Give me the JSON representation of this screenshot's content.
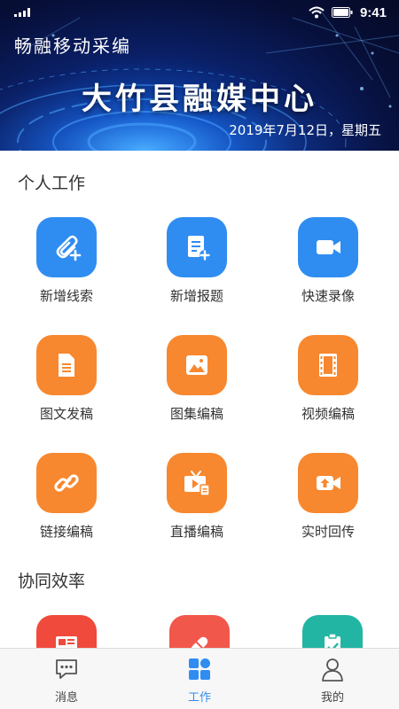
{
  "status_bar": {
    "time": "9:41"
  },
  "header": {
    "app_title": "畅融移动采编",
    "banner_title": "大竹县融媒中心",
    "date": "2019年7月12日，星期五"
  },
  "personal": {
    "title": "个人工作",
    "items": [
      {
        "label": "新增线索",
        "icon": "paperclip-add-icon",
        "color": "#2f8df1"
      },
      {
        "label": "新增报题",
        "icon": "document-add-icon",
        "color": "#2f8df1"
      },
      {
        "label": "快速录像",
        "icon": "video-camera-icon",
        "color": "#2f8df1"
      },
      {
        "label": "图文发稿",
        "icon": "document-icon",
        "color": "#f7882f"
      },
      {
        "label": "图集编稿",
        "icon": "image-icon",
        "color": "#f7882f"
      },
      {
        "label": "视频编稿",
        "icon": "film-strip-icon",
        "color": "#f7882f"
      },
      {
        "label": "链接编稿",
        "icon": "link-icon",
        "color": "#f7882f"
      },
      {
        "label": "直播编稿",
        "icon": "tv-icon",
        "color": "#f7882f"
      },
      {
        "label": "实时回传",
        "icon": "upload-video-icon",
        "color": "#f7882f"
      }
    ]
  },
  "collab": {
    "title": "协同效率",
    "items": [
      {
        "icon": "newspaper-icon",
        "color": "#f04a3c"
      },
      {
        "icon": "pill-icon",
        "color": "#f2574c"
      },
      {
        "icon": "clipboard-check-icon",
        "color": "#23b5a3"
      }
    ]
  },
  "tabbar": {
    "tabs": [
      {
        "label": "消息",
        "icon": "chat-bubble-icon"
      },
      {
        "label": "工作",
        "icon": "apps-grid-icon",
        "active": true
      },
      {
        "label": "我的",
        "icon": "person-icon"
      }
    ]
  }
}
